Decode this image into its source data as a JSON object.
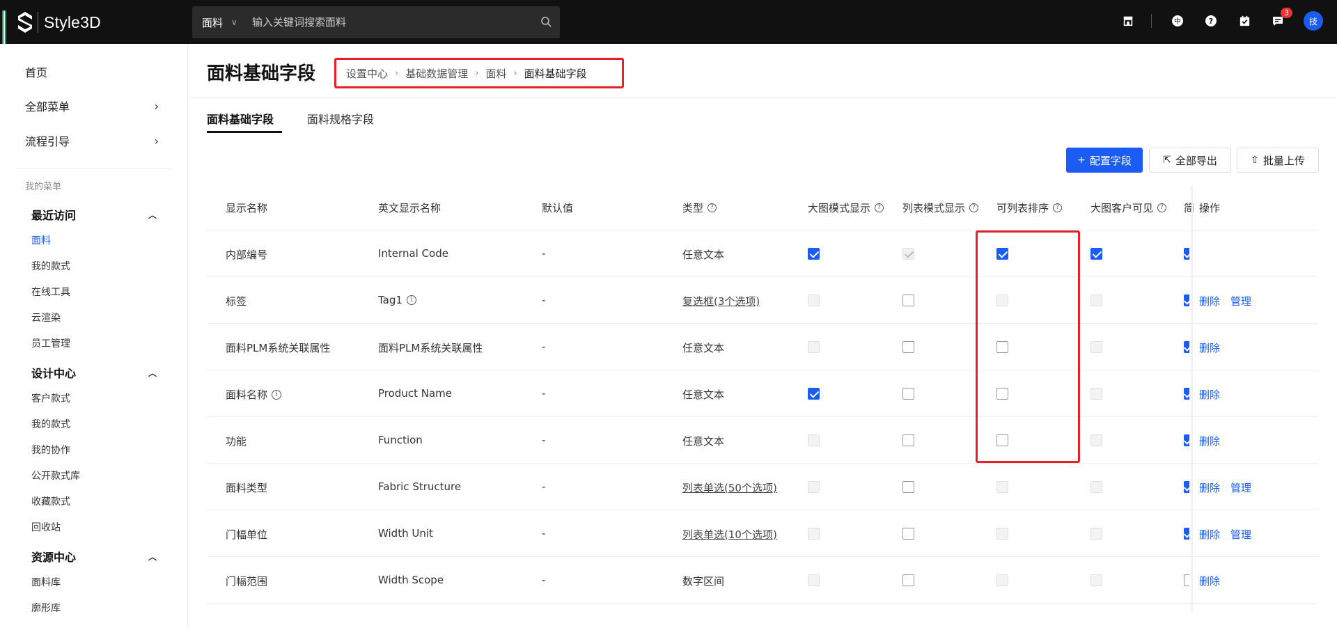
{
  "app": {
    "name": "Style3D"
  },
  "search": {
    "category": "面料",
    "placeholder": "输入关键词搜索面料"
  },
  "notifications": {
    "count": "3"
  },
  "user": {
    "avatar_text": "技"
  },
  "sidebar": {
    "top": [
      {
        "label": "首页"
      },
      {
        "label": "全部菜单"
      },
      {
        "label": "流程引导"
      }
    ],
    "caption": "我的菜单",
    "groups": [
      {
        "title": "最近访问",
        "items": [
          "面料",
          "我的款式",
          "在线工具",
          "云渲染",
          "员工管理"
        ]
      },
      {
        "title": "设计中心",
        "items": [
          "客户款式",
          "我的款式",
          "我的协作",
          "公开款式库",
          "收藏款式",
          "回收站"
        ]
      },
      {
        "title": "资源中心",
        "items": [
          "面料库",
          "廓形库"
        ]
      }
    ]
  },
  "page": {
    "title": "面料基础字段",
    "breadcrumb": [
      "设置中心",
      "基础数据管理",
      "面料",
      "面料基础字段"
    ],
    "tabs": [
      "面料基础字段",
      "面料规格字段"
    ],
    "buttons": {
      "config": "配置字段",
      "export": "全部导出",
      "upload": "批量上传"
    }
  },
  "table": {
    "columns": [
      "显示名称",
      "英文显示名称",
      "默认值",
      "类型",
      "大图模式显示",
      "列表模式显示",
      "可列表排序",
      "大图客户可见",
      "简",
      "操作"
    ],
    "rows": [
      {
        "name": "内部编号",
        "en": "Internal Code",
        "default": "-",
        "type": "任意文本",
        "ops": []
      },
      {
        "name": "标签",
        "en": "Tag1",
        "default": "-",
        "type": "复选框(3个选项)",
        "ops": [
          "删除",
          "管理"
        ]
      },
      {
        "name": "面料PLM系统关联属性",
        "en": "面料PLM系统关联属性",
        "default": "-",
        "type": "任意文本",
        "ops": [
          "删除"
        ]
      },
      {
        "name": "面料名称",
        "en": "Product Name",
        "default": "-",
        "type": "任意文本",
        "ops": [
          "删除"
        ]
      },
      {
        "name": "功能",
        "en": "Function",
        "default": "-",
        "type": "任意文本",
        "ops": [
          "删除"
        ]
      },
      {
        "name": "面料类型",
        "en": "Fabric Structure",
        "default": "-",
        "type": "列表单选(50个选项)",
        "ops": [
          "删除",
          "管理"
        ]
      },
      {
        "name": "门幅单位",
        "en": "Width Unit",
        "default": "-",
        "type": "列表单选(10个选项)",
        "ops": [
          "删除",
          "管理"
        ]
      },
      {
        "name": "门幅范围",
        "en": "Width Scope",
        "default": "-",
        "type": "数字区间",
        "ops": [
          "删除"
        ]
      }
    ]
  }
}
